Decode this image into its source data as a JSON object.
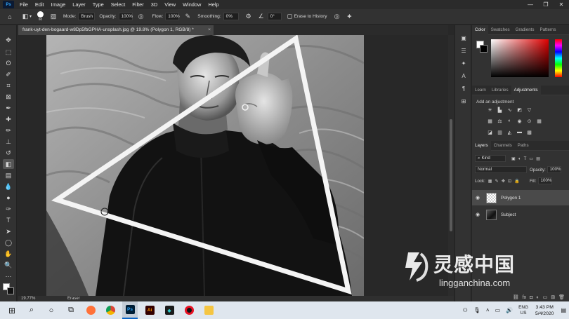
{
  "app": {
    "logo": "Ps"
  },
  "menu": [
    "File",
    "Edit",
    "Image",
    "Layer",
    "Type",
    "Select",
    "Filter",
    "3D",
    "View",
    "Window",
    "Help"
  ],
  "window_controls": [
    "—",
    "❐",
    "✕"
  ],
  "options_bar": {
    "brush_size": "90",
    "mode_label": "Mode:",
    "mode_value": "Brush",
    "opacity_label": "Opacity:",
    "opacity_value": "100%",
    "flow_label": "Flow:",
    "flow_value": "100%",
    "smoothing_label": "Smoothing:",
    "smoothing_value": "0%",
    "angle_value": "0°",
    "erase_to_history_label": "Erase to History"
  },
  "document_tab": {
    "title": "frank-uyt-den-bogaard-w8Dp5fbGPHA-unsplash.jpg @ 19.8% (Polygon 1, RGB/8) *",
    "close": "×"
  },
  "status_bar": {
    "zoom": "19.77%",
    "tool": "Eraser"
  },
  "panels": {
    "color_tabs": [
      "Color",
      "Swatches",
      "Gradients",
      "Patterns"
    ],
    "adjust_tabs": [
      "Learn",
      "Libraries",
      "Adjustments"
    ],
    "adjust_title": "Add an adjustment",
    "layers_tabs": [
      "Layers",
      "Channels",
      "Paths"
    ],
    "kind_label": "Kind",
    "blend_mode": "Normal",
    "opacity_label": "Opacity:",
    "opacity_value": "100%",
    "lock_label": "Lock:",
    "fill_label": "Fill:",
    "fill_value": "100%",
    "layers": [
      {
        "name": "Polygon 1",
        "selected": true
      },
      {
        "name": "Subject",
        "selected": false
      }
    ]
  },
  "watermark": {
    "title": "灵感中国",
    "url": "lingganchina.com"
  },
  "taskbar": {
    "lang_top": "ENG",
    "lang_bottom": "US",
    "time": "3:43 PM",
    "date": "5/4/2020",
    "app_labels": {
      "photoshop": "Ps",
      "illustrator": "Ai"
    }
  },
  "colors": {
    "accent": "#31a8ff",
    "canvas_bg": "#282828",
    "panel_bg": "#323232"
  }
}
